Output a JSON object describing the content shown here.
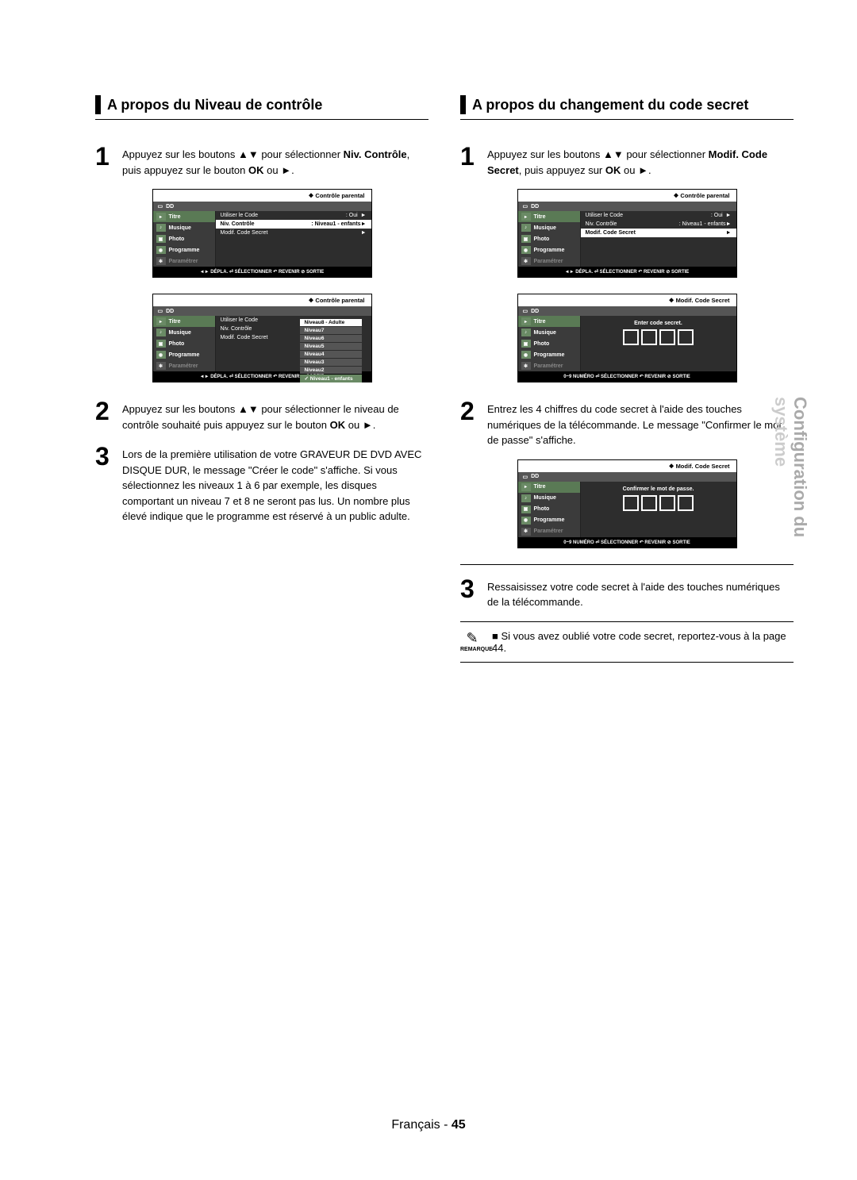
{
  "left": {
    "heading": "A propos du Niveau de contrôle",
    "step1": {
      "pre": "Appuyez sur les boutons ",
      "arrows": "▲▼",
      "mid": " pour sélectionner ",
      "bold1": "Niv. Contrôle",
      "mid2": ", puis appuyez sur le bouton ",
      "bold2": "OK",
      "mid3": " ou ",
      "arrow2": "►",
      "end": "."
    },
    "step2": {
      "pre": "Appuyez sur les boutons ",
      "arrows": "▲▼",
      "mid": " pour sélectionner le niveau de contrôle souhaité puis appuyez sur le bouton ",
      "bold": "OK",
      "mid2": " ou ",
      "arrow": "►",
      "end": "."
    },
    "step3": "Lors de la première utilisation de votre GRAVEUR DE DVD AVEC DISQUE DUR, le message \"Créer le code\" s'affiche. Si vous sélectionnez les niveaux 1 à 6 par exemple, les disques comportant un niveau 7 et 8 ne seront pas lus. Un nombre plus élevé indique que le programme est réservé à un public adulte."
  },
  "right": {
    "heading": "A propos du changement du code secret",
    "step1": {
      "pre": "Appuyez sur les boutons ",
      "arrows": "▲▼",
      "mid": " pour sélectionner ",
      "bold1": "Modif. Code Secret",
      "mid2": ", puis appuyez sur ",
      "bold2": "OK",
      "mid3": " ou ",
      "arrow2": "►",
      "end": "."
    },
    "step2": "Entrez les 4 chiffres du code secret à l'aide des touches numériques de la télécommande. Le message \"Confirmer le mot de passe\" s'affiche.",
    "step3": "Ressaisissez votre code secret à l'aide des touches numériques de la télécommande.",
    "note": "Si vous avez oublié votre code secret, reportez-vous à la page 44.",
    "note_label": "REMARQUE"
  },
  "osd": {
    "title_parental": "Contrôle parental",
    "title_modif": "Modif. Code Secret",
    "dd": "DD",
    "side": {
      "titre": "Titre",
      "musique": "Musique",
      "photo": "Photo",
      "programme": "Programme",
      "parametrer": "Paramétrer"
    },
    "main": {
      "use_code": "Utiliser le Code",
      "oui": ": Oui",
      "niv": "Niv. Contrôle",
      "niv_val": ": Niveau1 - enfants",
      "modif": "Modif. Code Secret"
    },
    "levels": [
      "Niveau8 - Adulte",
      "Niveau7",
      "Niveau6",
      "Niveau5",
      "Niveau4",
      "Niveau3",
      "Niveau2",
      "Niveau1 - enfants"
    ],
    "enter": "Enter code secret.",
    "confirm": "Confirmer le mot de passe.",
    "foot_move": "◄► DÉPLA.   ⏎ SÉLECTIONNER   ↶ REVENIR   ⊘ SORTIE",
    "foot_num": "0~9 NUMÉRO   ⏎ SÉLECTIONNER   ↶ REVENIR   ⊘ SORTIE"
  },
  "side_tab": {
    "l1": "Configuration du",
    "l2": "système"
  },
  "footer": {
    "lang": "Français",
    "dash": " - ",
    "page": "45"
  }
}
